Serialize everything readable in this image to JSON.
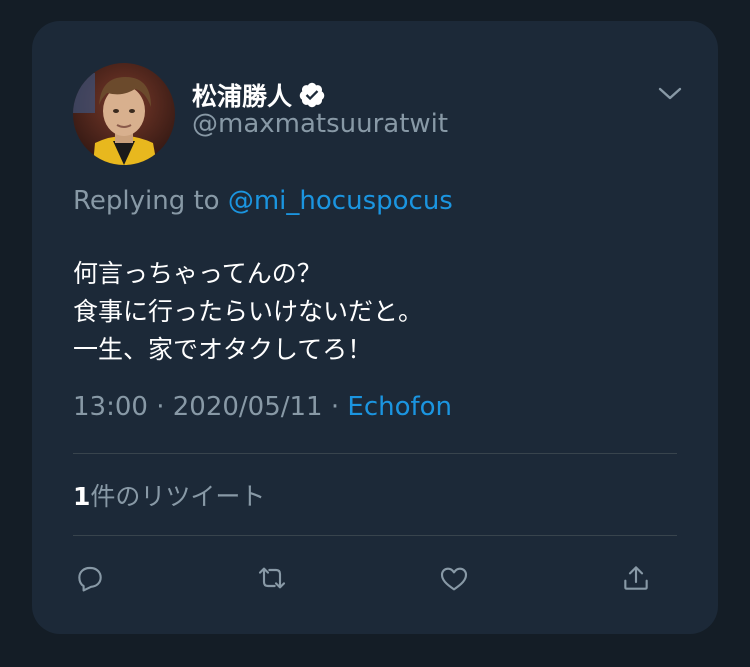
{
  "tweet": {
    "display_name": "松浦勝人",
    "handle": "@maxmatsuuratwit",
    "reply_prefix": "Replying to",
    "reply_to": "@mi_hocuspocus",
    "lines": [
      "何言っちゃってんの？",
      "食事に行ったらいけないだと。",
      "一生、家でオタクしてろ！"
    ],
    "time": "13:00",
    "separator": "·",
    "date": "2020/05/11",
    "source": "Echofon",
    "retweet_count": "1",
    "retweet_label": "件のリツイート"
  },
  "icons": {
    "verified": "verified-badge-icon",
    "caret": "chevron-down-icon",
    "reply": "reply-icon",
    "retweet": "retweet-icon",
    "like": "heart-icon",
    "share": "share-icon"
  },
  "colors": {
    "background": "#141d26",
    "card": "#1c2938",
    "secondary_text": "#8899a6",
    "link": "#1b95e0",
    "divider": "#38444d"
  }
}
